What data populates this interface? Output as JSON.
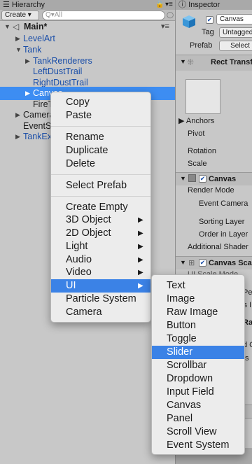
{
  "hierarchy": {
    "tab_title": "Hierarchy",
    "create_label": "Create",
    "search_placeholder": "Q▾All",
    "rows": [
      {
        "label": "Main*"
      },
      {
        "label": "LevelArt"
      },
      {
        "label": "Tank"
      },
      {
        "label": "TankRenderers"
      },
      {
        "label": "LeftDustTrail"
      },
      {
        "label": "RightDustTrail"
      },
      {
        "label": "Canvas"
      },
      {
        "label": "FireTransform"
      },
      {
        "label": "CameraRig"
      },
      {
        "label": "EventSystem"
      },
      {
        "label": "TankExplosion"
      }
    ]
  },
  "inspector": {
    "tab_title": "Inspector",
    "object_name": "Canvas",
    "tag_label": "Tag",
    "tag_value": "Untagged",
    "prefab_label": "Prefab",
    "prefab_button": "Select",
    "rect_transform_title": "Rect Transform",
    "anchors_label": "Anchors",
    "pivot_label": "Pivot",
    "rotation_label": "Rotation",
    "scale_label": "Scale",
    "canvas_title": "Canvas",
    "render_mode_label": "Render Mode",
    "event_camera_label": "Event Camera",
    "sorting_layer_label": "Sorting Layer",
    "order_in_layer_label": "Order in Layer",
    "additional_shader_label": "Additional Shader",
    "canvas_scaler_title": "Canvas Scaler",
    "ui_scale_mode_label": "UI Scale Mode",
    "partial_pe": "Pe",
    "partial_ls": "ls I",
    "partial_ra": "Ra",
    "partial_d": "d C",
    "partial_ts": "ts"
  },
  "context_menu": {
    "items": [
      {
        "label": "Copy"
      },
      {
        "label": "Paste"
      },
      {
        "label": "Rename"
      },
      {
        "label": "Duplicate"
      },
      {
        "label": "Delete"
      },
      {
        "label": "Select Prefab"
      },
      {
        "label": "Create Empty"
      },
      {
        "label": "3D Object"
      },
      {
        "label": "2D Object"
      },
      {
        "label": "Light"
      },
      {
        "label": "Audio"
      },
      {
        "label": "Video"
      },
      {
        "label": "UI"
      },
      {
        "label": "Particle System"
      },
      {
        "label": "Camera"
      }
    ],
    "highlighted": "UI"
  },
  "ui_submenu": {
    "items": [
      {
        "label": "Text"
      },
      {
        "label": "Image"
      },
      {
        "label": "Raw Image"
      },
      {
        "label": "Button"
      },
      {
        "label": "Toggle"
      },
      {
        "label": "Slider"
      },
      {
        "label": "Scrollbar"
      },
      {
        "label": "Dropdown"
      },
      {
        "label": "Input Field"
      },
      {
        "label": "Canvas"
      },
      {
        "label": "Panel"
      },
      {
        "label": "Scroll View"
      },
      {
        "label": "Event System"
      }
    ],
    "highlighted": "Slider"
  },
  "colors": {
    "selection": "#3d8df2",
    "menu_highlight": "#3b82e6",
    "prefab_text": "#1a4ea8"
  }
}
